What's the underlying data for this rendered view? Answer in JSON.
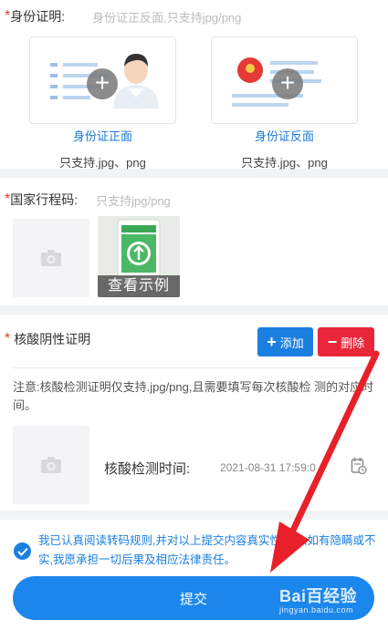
{
  "id_section": {
    "required_mark": "*",
    "label": "身份证明:",
    "hint": "身份证正反面,只支持jpg/png",
    "front_link": "身份证正面",
    "back_link": "身份证反面",
    "front_note": "只支持.jpg、png",
    "back_note": "只支持.jpg、png"
  },
  "code_section": {
    "required_mark": "*",
    "label": "国家行程码:",
    "hint": "只支持jpg/png",
    "example_label": "查看示例"
  },
  "nucleic_section": {
    "required_mark": "*",
    "label": "核酸阴性证明",
    "add_label": "添加",
    "delete_label": "删除",
    "note": "注意:核酸检测证明仅支持.jpg/png,且需要填写每次核酸检 测的对应时间。",
    "time_label": "核酸检测时间:",
    "time_value": "2021-08-31 17:59:0"
  },
  "agreement": {
    "checked": true,
    "text": "我已认真阅读转码规则,并对以上提交内容真实性负责,如有隐瞒或不实,我愿承担一切后果及相应法律责任。"
  },
  "submit": {
    "label": "提交"
  },
  "watermark": {
    "main": "Bai百经验",
    "sub": "jingyan.baidu.com"
  },
  "colors": {
    "accent": "#1b7fe0",
    "danger": "#e8283a",
    "required": "#e53935",
    "arrow": "#e8202a"
  },
  "icons": [
    "plus-icon",
    "camera-icon",
    "calendar-icon",
    "check-icon",
    "delete-icon"
  ]
}
